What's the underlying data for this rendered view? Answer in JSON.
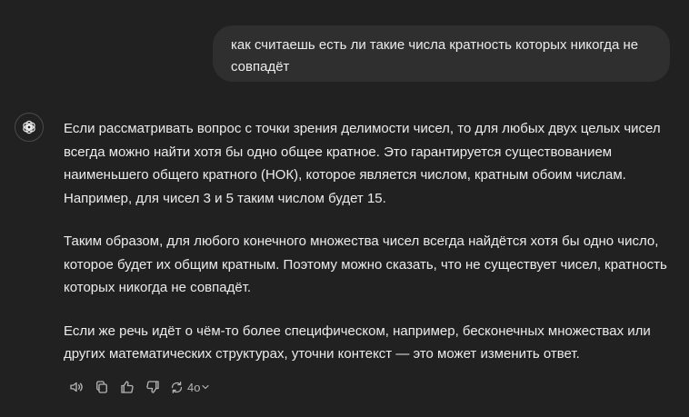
{
  "user_message": {
    "text": "как считаешь есть ли такие числа кратность которых никогда не совпадёт"
  },
  "assistant_message": {
    "avatar_icon": "openai-logo-icon",
    "paragraphs": [
      "Если рассматривать вопрос с точки зрения делимости чисел, то для любых двух целых чисел всегда можно найти хотя бы одно общее кратное. Это гарантируется существованием наименьшего общего кратного (НОК), которое является числом, кратным обоим числам. Например, для чисел 3 и 5 таким числом будет 15.",
      "Таким образом, для любого конечного множества чисел всегда найдётся хотя бы одно число, которое будет их общим кратным. Поэтому можно сказать, что не существует чисел, кратность которых никогда не совпадёт.",
      "Если же речь идёт о чём-то более специфическом, например, бесконечных множествах или других математических структурах, уточни контекст — это может изменить ответ."
    ]
  },
  "actions": {
    "icons": [
      "speaker-icon",
      "copy-icon",
      "thumbs-up-icon",
      "thumbs-down-icon",
      "regenerate-icon",
      "chevron-down-icon"
    ],
    "model_label": "4o"
  },
  "colors": {
    "background": "#212121",
    "user_bubble": "#2f2f2f",
    "text": "#ececec",
    "icon": "#b4b4b4"
  }
}
